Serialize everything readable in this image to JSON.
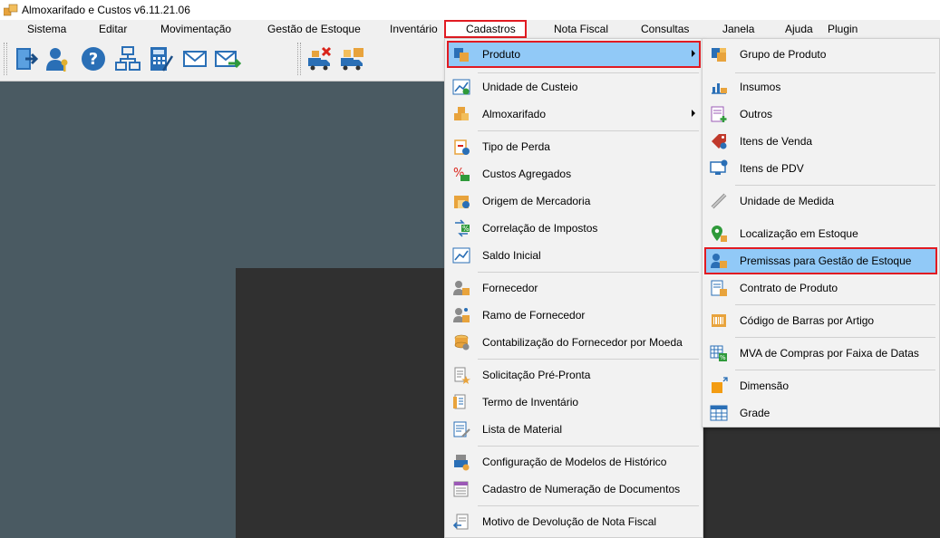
{
  "window": {
    "title": "Almoxarifado e Custos v6.11.21.06"
  },
  "menubar": {
    "items": [
      {
        "label": "Sistema"
      },
      {
        "label": "Editar"
      },
      {
        "label": "Movimentação"
      },
      {
        "label": "Gestão de Estoque"
      },
      {
        "label": "Inventário"
      },
      {
        "label": "Cadastros"
      },
      {
        "label": "Nota Fiscal"
      },
      {
        "label": "Consultas"
      },
      {
        "label": "Janela"
      },
      {
        "label": "Ajuda"
      },
      {
        "label": "Plugin"
      }
    ]
  },
  "toolbar": {
    "buttons": [
      {
        "icon": "exit-icon"
      },
      {
        "icon": "user-key-icon"
      },
      {
        "icon": "help-icon"
      },
      {
        "icon": "org-chart-icon"
      },
      {
        "icon": "calculator-icon"
      },
      {
        "icon": "mail-icon"
      },
      {
        "icon": "mail-send-icon"
      },
      {
        "icon": "truck-cancel-icon"
      },
      {
        "icon": "truck-box-icon"
      }
    ]
  },
  "cadastros_menu": {
    "items": [
      {
        "label": "Produto",
        "icon": "product-icon",
        "submenu": true
      },
      {
        "label": "Unidade de Custeio",
        "icon": "chart-money-icon"
      },
      {
        "label": "Almoxarifado",
        "icon": "boxes-icon",
        "submenu": true
      },
      {
        "label": "Tipo de Perda",
        "icon": "clipboard-minus-icon"
      },
      {
        "label": "Custos Agregados",
        "icon": "percent-money-icon"
      },
      {
        "label": "Origem de Mercadoria",
        "icon": "warehouse-icon"
      },
      {
        "label": "Correlação de Impostos",
        "icon": "tax-icon"
      },
      {
        "label": "Saldo Inicial",
        "icon": "chart-balance-icon"
      },
      {
        "label": "Fornecedor",
        "icon": "supplier-icon"
      },
      {
        "label": "Ramo de Fornecedor",
        "icon": "supplier-branch-icon"
      },
      {
        "label": "Contabilização do Fornecedor por Moeda",
        "icon": "coins-icon"
      },
      {
        "label": "Solicitação Pré-Pronta",
        "icon": "document-star-icon"
      },
      {
        "label": "Termo de Inventário",
        "icon": "inventory-term-icon"
      },
      {
        "label": "Lista de Material",
        "icon": "material-list-icon"
      },
      {
        "label": "Configuração de Modelos de Histórico",
        "icon": "history-config-icon"
      },
      {
        "label": "Cadastro de Numeração de Documentos",
        "icon": "numbering-icon"
      },
      {
        "label": "Motivo de Devolução de Nota Fiscal",
        "icon": "return-invoice-icon"
      }
    ]
  },
  "produto_submenu": {
    "items": [
      {
        "label": "Grupo de Produto",
        "icon": "product-group-icon"
      },
      {
        "label": "Insumos",
        "icon": "supplies-icon"
      },
      {
        "label": "Outros",
        "icon": "others-icon"
      },
      {
        "label": "Itens de Venda",
        "icon": "price-tag-icon"
      },
      {
        "label": "Itens de PDV",
        "icon": "pos-icon"
      },
      {
        "label": "Unidade de Medida",
        "icon": "ruler-icon"
      },
      {
        "label": "Localização em Estoque",
        "icon": "location-pin-icon"
      },
      {
        "label": "Premissas para Gestão de Estoque",
        "icon": "stock-premises-icon"
      },
      {
        "label": "Contrato de Produto",
        "icon": "contract-icon"
      },
      {
        "label": "Código de Barras por Artigo",
        "icon": "barcode-icon"
      },
      {
        "label": "MVA de Compras por Faixa de Datas",
        "icon": "mva-icon"
      },
      {
        "label": "Dimensão",
        "icon": "dimension-icon"
      },
      {
        "label": "Grade",
        "icon": "grid-icon"
      }
    ]
  },
  "colors": {
    "highlight": "#91c9f7",
    "callout_border": "#e11b22",
    "workspace": "#4a5a62",
    "workspace_dark": "#303030"
  }
}
